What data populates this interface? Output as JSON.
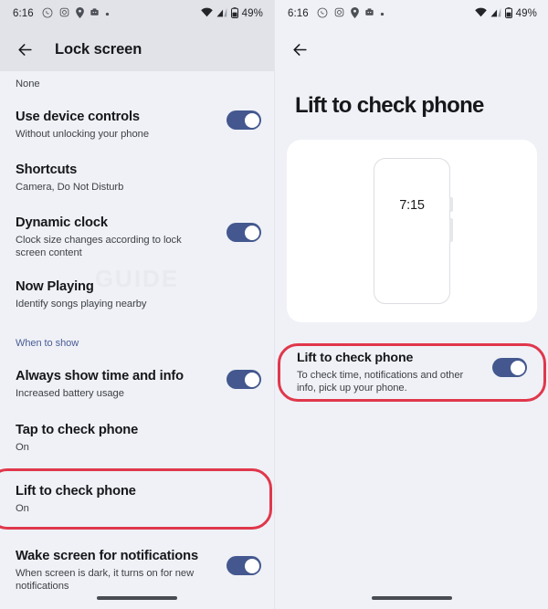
{
  "status_bar": {
    "time": "6:16",
    "battery_text": "49%",
    "left_icons": [
      "whatsapp-icon",
      "instagram-icon",
      "location-icon",
      "app-icon",
      "dot-icon"
    ],
    "right_icons": [
      "wifi-icon",
      "cellular-signal-icon",
      "battery-icon"
    ]
  },
  "left_screen": {
    "toolbar": {
      "title": "Lock screen",
      "back_icon": "back-arrow-icon"
    },
    "first_value": "None",
    "section_label": "When to show",
    "items": [
      {
        "title": "Use device controls",
        "subtitle": "Without unlocking your phone",
        "toggle": true,
        "toggle_on": true
      },
      {
        "title": "Shortcuts",
        "subtitle": "Camera, Do Not Disturb",
        "toggle": false,
        "toggle_on": false
      },
      {
        "title": "Dynamic clock",
        "subtitle": "Clock size changes according to lock screen content",
        "toggle": true,
        "toggle_on": true
      },
      {
        "title": "Now Playing",
        "subtitle": "Identify songs playing nearby",
        "toggle": false,
        "toggle_on": false
      },
      {
        "title": "Always show time and info",
        "subtitle": "Increased battery usage",
        "toggle": true,
        "toggle_on": true
      },
      {
        "title": "Tap to check phone",
        "subtitle": "On",
        "toggle": false,
        "toggle_on": false
      },
      {
        "title": "Lift to check phone",
        "subtitle": "On",
        "toggle": false,
        "toggle_on": false
      },
      {
        "title": "Wake screen for notifications",
        "subtitle": "When screen is dark, it turns on for new notifications",
        "toggle": true,
        "toggle_on": true
      }
    ],
    "highlight_color": "#e0374c",
    "highlighted_item": "Lift to check phone"
  },
  "right_screen": {
    "toolbar": {
      "back_icon": "back-arrow-icon"
    },
    "page_title": "Lift to check phone",
    "illustration": {
      "phone_time": "7:15",
      "name": "phone-illustration"
    },
    "setting": {
      "title": "Lift to check phone",
      "subtitle": "To check time, notifications and other info, pick up your phone.",
      "toggle_on": true
    },
    "highlight_color": "#e0374c"
  },
  "colors": {
    "accent_toggle": "#44588f",
    "highlight": "#e0374c",
    "background": "#eff1f6",
    "toolbar_background": "#e2e3e8",
    "section_label": "#4a5c96"
  },
  "gesture_bar": "home-gesture-bar"
}
